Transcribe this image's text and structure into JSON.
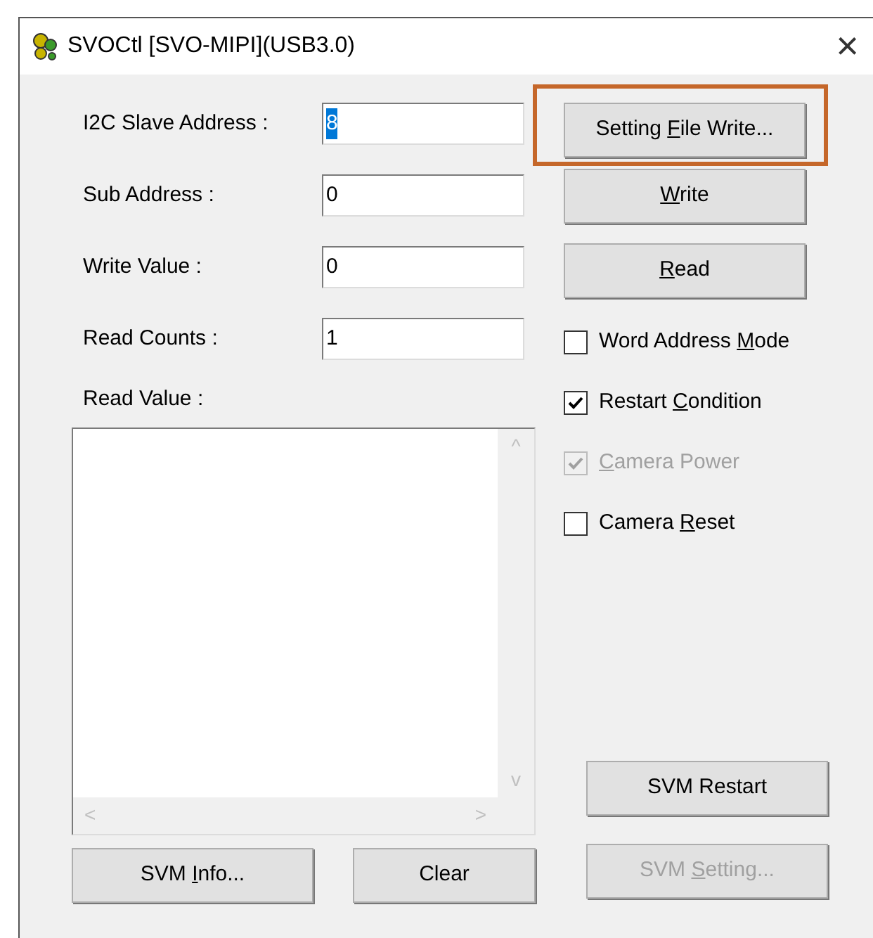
{
  "window": {
    "title": "SVOCtl [SVO-MIPI](USB3.0)",
    "close": "×"
  },
  "fields": [
    {
      "label": "I2C Slave Address :",
      "value": "8",
      "selected": true
    },
    {
      "label": "Sub Address :",
      "value": "0",
      "selected": false
    },
    {
      "label": "Write Value :",
      "value": "0",
      "selected": false
    },
    {
      "label": "Read Counts :",
      "value": "1",
      "selected": false
    }
  ],
  "read_value": {
    "label": "Read Value :",
    "scroll_up": "^",
    "scroll_down": "v",
    "scroll_left": "<",
    "scroll_right": ">"
  },
  "side_buttons": [
    {
      "parts": [
        {
          "text": "Setting ",
          "access_key": false
        },
        {
          "text": "F",
          "access_key": true
        },
        {
          "text": "ile Write...",
          "access_key": false
        }
      ],
      "highlighted": true,
      "disabled": false
    },
    {
      "parts": [
        {
          "text": "W",
          "access_key": true
        },
        {
          "text": "rite",
          "access_key": false
        }
      ],
      "highlighted": false,
      "disabled": false
    },
    {
      "parts": [
        {
          "text": "R",
          "access_key": true
        },
        {
          "text": "ead",
          "access_key": false
        }
      ],
      "highlighted": false,
      "disabled": false
    }
  ],
  "checkboxes": [
    {
      "parts": [
        {
          "text": "Word Address ",
          "access_key": false
        },
        {
          "text": "M",
          "access_key": true
        },
        {
          "text": "ode",
          "access_key": false
        }
      ],
      "checked": false,
      "disabled": false
    },
    {
      "parts": [
        {
          "text": "Restart ",
          "access_key": false
        },
        {
          "text": "C",
          "access_key": true
        },
        {
          "text": "ondition",
          "access_key": false
        }
      ],
      "checked": true,
      "disabled": false
    },
    {
      "parts": [
        {
          "text": "C",
          "access_key": true
        },
        {
          "text": "amera Power",
          "access_key": false
        }
      ],
      "checked": true,
      "disabled": true
    },
    {
      "parts": [
        {
          "text": "Camera ",
          "access_key": false
        },
        {
          "text": "R",
          "access_key": true
        },
        {
          "text": "eset",
          "access_key": false
        }
      ],
      "checked": false,
      "disabled": false
    }
  ],
  "restart_button": {
    "parts": [
      {
        "text": "SVM Restart",
        "access_key": false
      }
    ],
    "disabled": false
  },
  "bottom_buttons": [
    {
      "parts": [
        {
          "text": "SVM ",
          "access_key": false
        },
        {
          "text": "I",
          "access_key": true
        },
        {
          "text": "nfo...",
          "access_key": false
        }
      ],
      "disabled": false
    },
    {
      "parts": [
        {
          "text": "Clear",
          "access_key": false
        }
      ],
      "disabled": false
    },
    {
      "parts": [
        {
          "text": "SVM ",
          "access_key": false
        },
        {
          "text": "S",
          "access_key": true
        },
        {
          "text": "etting...",
          "access_key": false
        }
      ],
      "disabled": true
    }
  ]
}
